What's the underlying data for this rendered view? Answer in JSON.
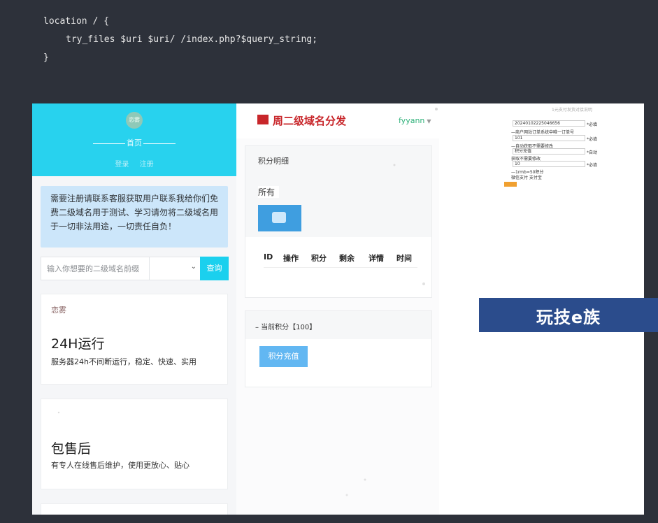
{
  "code": {
    "line1": "location / {",
    "line2": "try_files $uri $uri/ /index.php?$query_string;",
    "line3": "}"
  },
  "left_panel": {
    "avatar_text": "恋雾",
    "home_label": "首页",
    "login_label": "登录",
    "register_label": "注册",
    "notice_text": "需要注册请联系客服获取用户联系我给你们免费二级域名用于测试、学习请勿将二级域名用于一切非法用途，一切责任自负！",
    "search": {
      "placeholder": "输入你想要的二级域名前缀",
      "select_value": "",
      "button_label": "查询"
    },
    "cards": [
      {
        "logo": "恋雾",
        "title": "24H运行",
        "desc": "服务器24h不间断运行，稳定、快速、实用"
      },
      {
        "logo": "",
        "title": "包售后",
        "desc": "有专人在线售后维护，使用更放心、贴心"
      }
    ]
  },
  "middle_panel": {
    "site_title": "周二级域名分发",
    "username": "fyyann",
    "points_title": "积分明细",
    "filter_label": "所有",
    "table_headers": [
      "ID",
      "操作",
      "积分",
      "剩余",
      "详情",
      "时间"
    ],
    "recharge_title": "– 当前积分【100】",
    "recharge_button": "积分充值"
  },
  "mini_form": {
    "title": "1元支付发货对接说明",
    "order_value": "20240102225046656",
    "order_hint": "—商户网站订单系统中唯一订单号",
    "amount_value": "101",
    "amount_hint": "—自动获取不需要修改",
    "name_value": "积分充值",
    "name_hint": "获取不需要修改",
    "points_value": "10",
    "points_hint": "—1rmb=50积分",
    "pay_option": "微信支付 支付宝",
    "required": "*必填",
    "auto": "*自动"
  },
  "banner_text": "玩技e族",
  "colors": {
    "hero": "#28d2ee",
    "notice_bg": "#cce6fa",
    "search_button": "#1bd0ee",
    "brand_red": "#c8262a",
    "recharge_button": "#62b7f2",
    "banner": "#2b4c8c"
  }
}
